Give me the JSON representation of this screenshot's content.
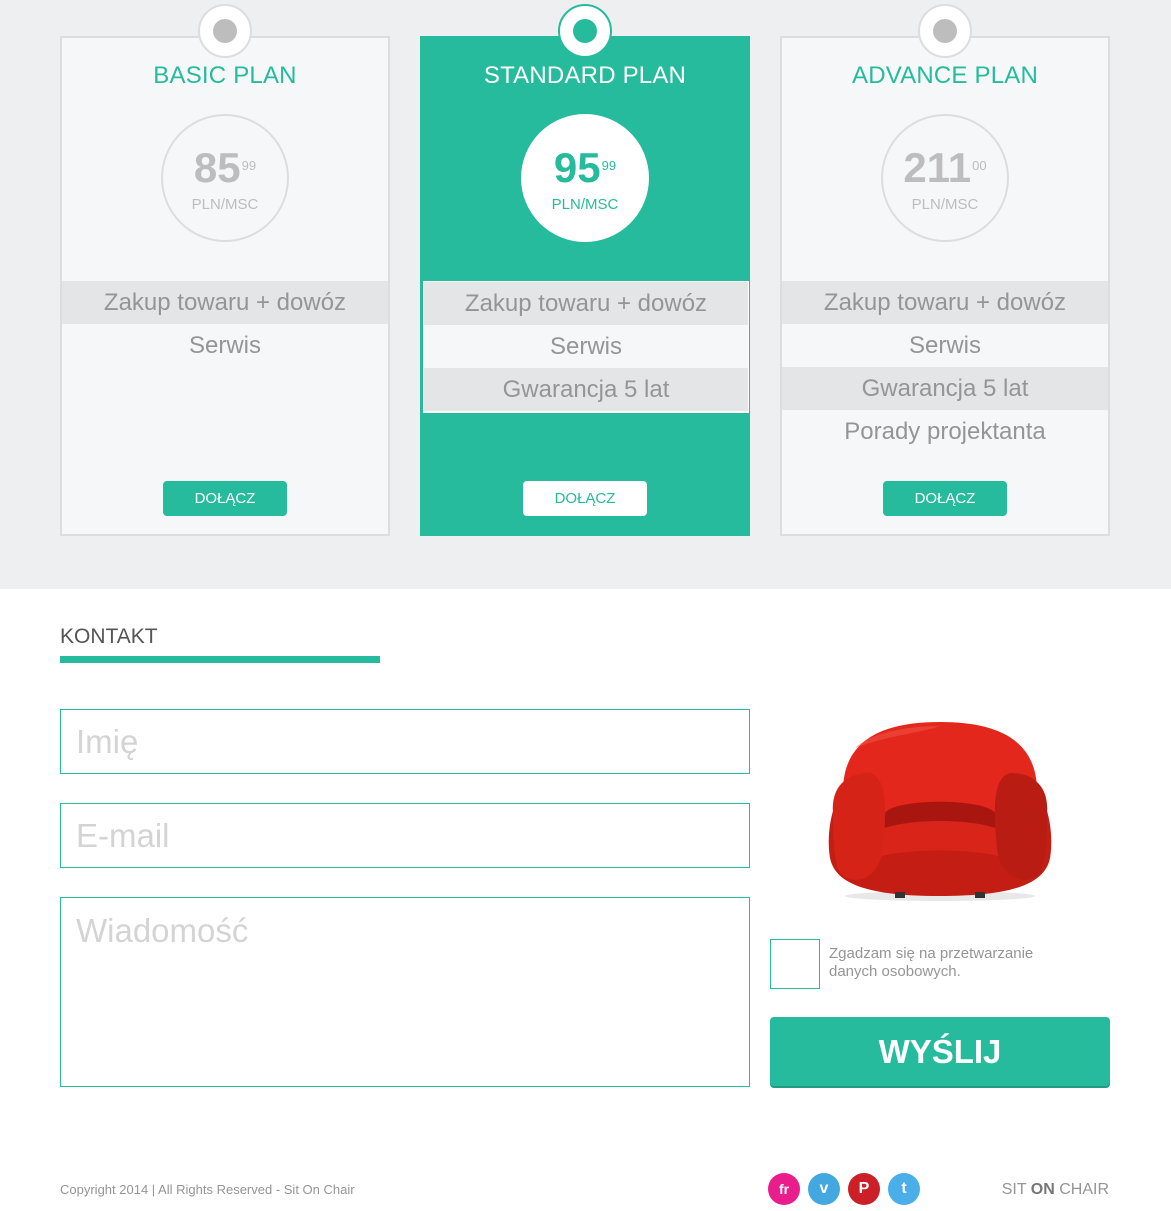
{
  "pricing": {
    "plans": [
      {
        "title": "BASIC PLAN",
        "price": "85",
        "cents": "99",
        "unit": "PLN/MSC",
        "features": [
          "Zakup towaru + dowóz",
          "Serwis"
        ],
        "button": "DOŁĄCZ"
      },
      {
        "title": "STANDARD PLAN",
        "price": "95",
        "cents": "99",
        "unit": "PLN/MSC",
        "features": [
          "Zakup towaru + dowóz",
          "Serwis",
          "Gwarancja 5 lat"
        ],
        "button": "DOŁĄCZ"
      },
      {
        "title": "ADVANCE PLAN",
        "price": "211",
        "cents": "00",
        "unit": "PLN/MSC",
        "features": [
          "Zakup towaru + dowóz",
          "Serwis",
          "Gwarancja 5 lat",
          "Porady projektanta"
        ],
        "button": "DOŁĄCZ"
      }
    ]
  },
  "contact": {
    "title": "KONTAKT",
    "name_placeholder": "Imię",
    "email_placeholder": "E-mail",
    "message_placeholder": "Wiadomość",
    "consent": "Zgadzam się na przetwarzanie danych osobowych.",
    "send": "WYŚLIJ"
  },
  "footer": {
    "copyright": "Copyright 2014 | All Rights Reserved - Sit On Chair",
    "social": [
      {
        "icon": "flickr-icon",
        "glyph": "fr",
        "color": "#e91e8c"
      },
      {
        "icon": "vimeo-icon",
        "glyph": "v",
        "color": "#44a8e0"
      },
      {
        "icon": "pinterest-icon",
        "glyph": "P",
        "color": "#cb2027"
      },
      {
        "icon": "twitter-icon",
        "glyph": "t",
        "color": "#4aaee8"
      }
    ],
    "brand_a": "SIT",
    "brand_b": "ON",
    "brand_c": "CHAIR"
  },
  "colors": {
    "accent": "#26bb9c",
    "chair": "#e4271c"
  }
}
